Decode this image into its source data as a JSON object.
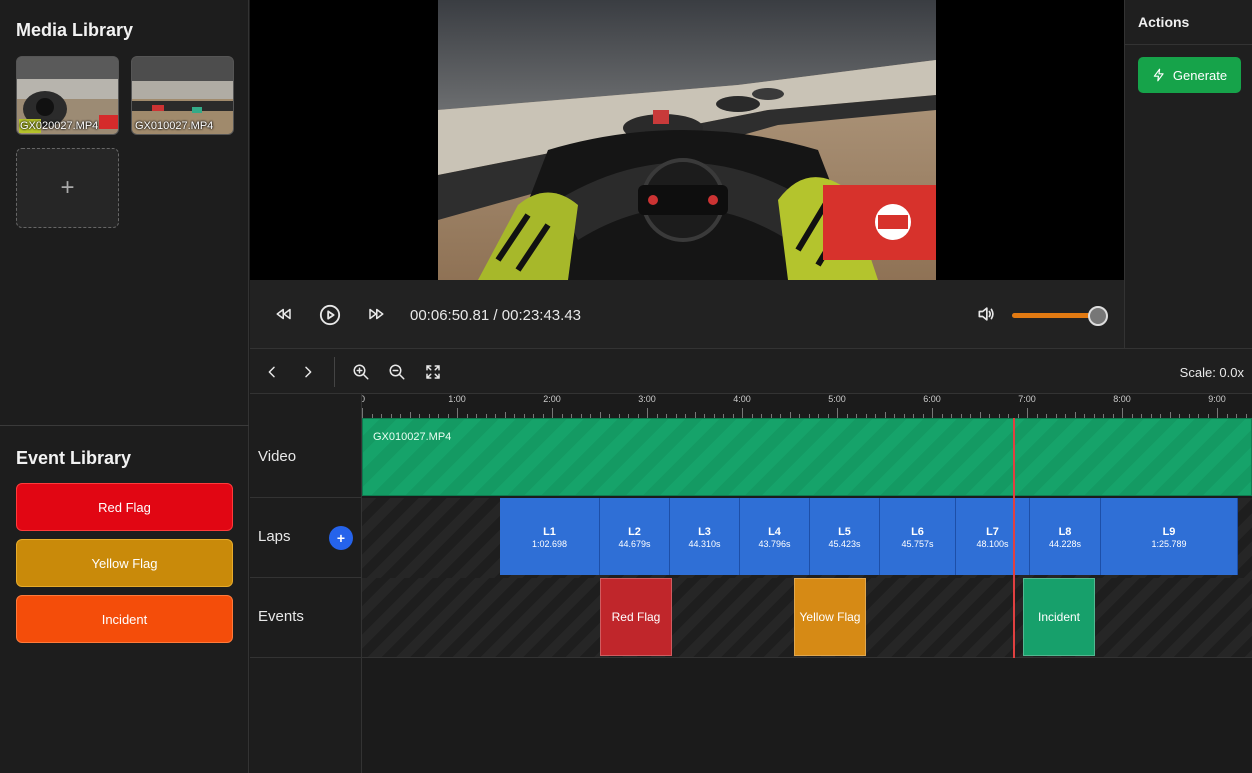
{
  "media_library": {
    "title": "Media Library",
    "items": [
      {
        "label": "GX020027.MP4"
      },
      {
        "label": "GX010027.MP4"
      }
    ],
    "add_icon": "+"
  },
  "event_library": {
    "title": "Event Library",
    "items": [
      {
        "label": "Red Flag",
        "color": "#e10613"
      },
      {
        "label": "Yellow Flag",
        "color": "#c98a0a"
      },
      {
        "label": "Incident",
        "color": "#f44d0a"
      }
    ]
  },
  "player": {
    "current_time": "00:06:50.81",
    "separator": " / ",
    "total_time": "00:23:43.43",
    "volume_percent": 100
  },
  "actions": {
    "title": "Actions",
    "generate_label": "Generate"
  },
  "timeline": {
    "scale_label": "Scale: 0.0x",
    "ruler_labels": [
      "0",
      "1:00",
      "2:00",
      "3:00",
      "4:00",
      "5:00",
      "6:00",
      "7:00",
      "8:00",
      "9:00"
    ],
    "tracks": {
      "video": "Video",
      "laps": "Laps",
      "events": "Events"
    },
    "add_lap_icon": "+",
    "video_clip": {
      "label": "GX010027.MP4"
    },
    "laps": [
      {
        "name": "L1",
        "time": "1:02.698"
      },
      {
        "name": "L2",
        "time": "44.679s"
      },
      {
        "name": "L3",
        "time": "44.310s"
      },
      {
        "name": "L4",
        "time": "43.796s"
      },
      {
        "name": "L5",
        "time": "45.423s"
      },
      {
        "name": "L6",
        "time": "45.757s"
      },
      {
        "name": "L7",
        "time": "48.100s"
      },
      {
        "name": "L8",
        "time": "44.228s"
      },
      {
        "name": "L9",
        "time": "1:25.789"
      }
    ],
    "events": [
      {
        "label": "Red Flag",
        "color": "#c0262b"
      },
      {
        "label": "Yellow Flag",
        "color": "#d68a15"
      },
      {
        "label": "Incident",
        "color": "#17a06b"
      }
    ]
  }
}
